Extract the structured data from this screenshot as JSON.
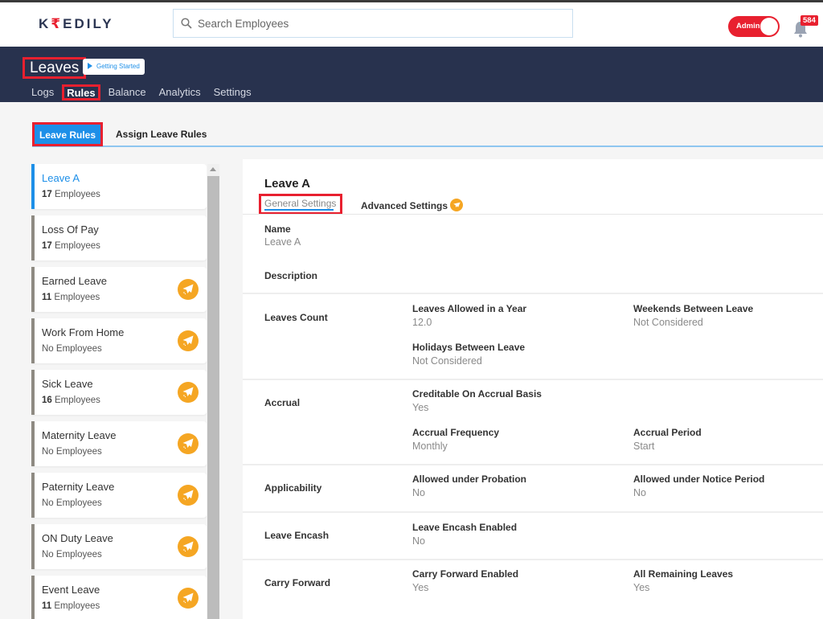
{
  "brand": {
    "logo_k": "K",
    "logo_r": "₹",
    "logo_rest": "EDILY",
    "accent": "#e8202f",
    "primary": "#1d8fe8",
    "header_bg": "#28324e"
  },
  "search": {
    "placeholder": "Search Employees",
    "value": ""
  },
  "admin_toggle": {
    "label": "Admin",
    "on": true
  },
  "notifications": {
    "count": "584"
  },
  "page": {
    "title": "Leaves",
    "getting_started": "Getting Started",
    "subnav": [
      {
        "label": "Logs",
        "active": false
      },
      {
        "label": "Rules",
        "active": true
      },
      {
        "label": "Balance",
        "active": false
      },
      {
        "label": "Analytics",
        "active": false
      },
      {
        "label": "Settings",
        "active": false
      }
    ]
  },
  "tabs": [
    {
      "label": "Leave Rules",
      "active": true
    },
    {
      "label": "Assign Leave Rules",
      "active": false
    }
  ],
  "rules": [
    {
      "name": "Leave A",
      "count": "17",
      "suffix": " Employees",
      "active": true,
      "plane": false
    },
    {
      "name": "Loss Of Pay",
      "count": "17",
      "suffix": " Employees",
      "active": false,
      "plane": false
    },
    {
      "name": "Earned Leave",
      "count": "11",
      "suffix": " Employees",
      "active": false,
      "plane": true
    },
    {
      "name": "Work From Home",
      "count": "",
      "suffix": "No Employees",
      "active": false,
      "plane": true
    },
    {
      "name": "Sick Leave",
      "count": "16",
      "suffix": " Employees",
      "active": false,
      "plane": true
    },
    {
      "name": "Maternity Leave",
      "count": "",
      "suffix": "No Employees",
      "active": false,
      "plane": true
    },
    {
      "name": "Paternity Leave",
      "count": "",
      "suffix": "No Employees",
      "active": false,
      "plane": true
    },
    {
      "name": "ON Duty Leave",
      "count": "",
      "suffix": "No Employees",
      "active": false,
      "plane": true
    },
    {
      "name": "Event Leave",
      "count": "11",
      "suffix": " Employees",
      "active": false,
      "plane": true
    }
  ],
  "detail": {
    "title": "Leave A",
    "tab_general": "General Settings",
    "tab_advanced": "Advanced Settings",
    "name_label": "Name",
    "name_value": "Leave A",
    "description_label": "Description",
    "sections": {
      "leaves_count": {
        "title": "Leaves Count",
        "allowed_label": "Leaves Allowed in a Year",
        "allowed_value": "12.0",
        "weekends_label": "Weekends Between Leave",
        "weekends_value": "Not Considered",
        "holidays_label": "Holidays Between Leave",
        "holidays_value": "Not Considered"
      },
      "accrual": {
        "title": "Accrual",
        "creditable_label": "Creditable On Accrual Basis",
        "creditable_value": "Yes",
        "frequency_label": "Accrual Frequency",
        "frequency_value": "Monthly",
        "period_label": "Accrual Period",
        "period_value": "Start"
      },
      "applicability": {
        "title": "Applicability",
        "probation_label": "Allowed under Probation",
        "probation_value": "No",
        "notice_label": "Allowed under Notice Period",
        "notice_value": "No"
      },
      "encash": {
        "title": "Leave Encash",
        "enabled_label": "Leave Encash Enabled",
        "enabled_value": "No"
      },
      "carry": {
        "title": "Carry Forward",
        "enabled_label": "Carry Forward Enabled",
        "enabled_value": "Yes",
        "remaining_label": "All Remaining Leaves",
        "remaining_value": "Yes"
      }
    }
  }
}
